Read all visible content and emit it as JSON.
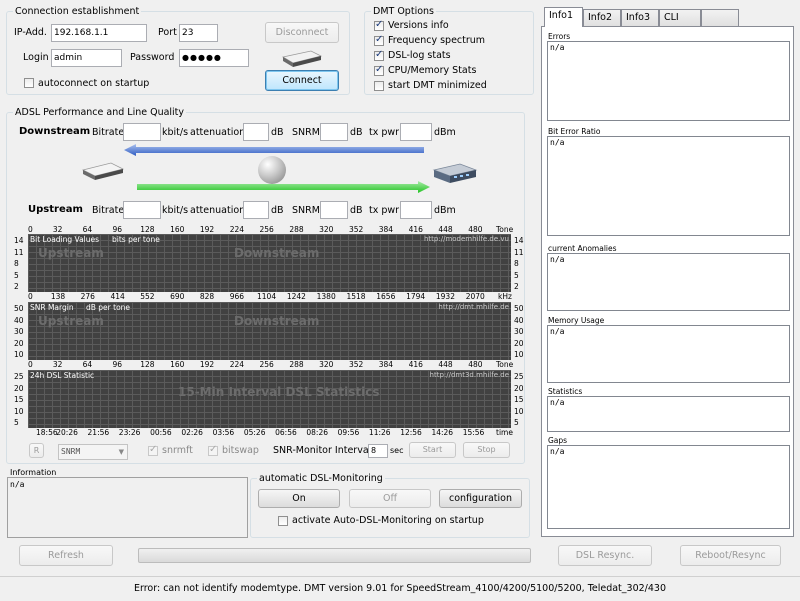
{
  "connection": {
    "title": "Connection establishment",
    "ip_label": "IP-Add.",
    "ip_value": "192.168.1.1",
    "port_label": "Port",
    "port_value": "23",
    "login_label": "Login",
    "login_value": "admin",
    "password_label": "Password",
    "password_value": "●●●●●",
    "disconnect_label": "Disconnect",
    "connect_label": "Connect",
    "autoconnect_label": "autoconnect on startup",
    "autoconnect_checked": false
  },
  "dmt_options": {
    "title": "DMT Options",
    "items": [
      {
        "label": "Versions info",
        "checked": true
      },
      {
        "label": "Frequency spectrum",
        "checked": true
      },
      {
        "label": "DSL-log stats",
        "checked": true
      },
      {
        "label": "CPU/Memory Stats",
        "checked": true
      },
      {
        "label": "start DMT minimized",
        "checked": false
      }
    ]
  },
  "adsl": {
    "title": "ADSL Performance and Line Quality",
    "downstream_label": "Downstream",
    "upstream_label": "Upstream",
    "bitrate_label": "Bitrate",
    "bitrate_unit": "kbit/s",
    "attenuation_label": "attenuation",
    "db_unit": "dB",
    "snrm_label": "SNRM",
    "txpwr_label": "tx pwr",
    "dbm_unit": "dBm",
    "downstream_values": {
      "bitrate": "",
      "attenuation": "",
      "snrm": "",
      "txpwr": ""
    },
    "upstream_values": {
      "bitrate": "",
      "attenuation": "",
      "snrm": "",
      "txpwr": ""
    }
  },
  "charts": {
    "tone_axis": [
      "0",
      "32",
      "64",
      "96",
      "128",
      "160",
      "192",
      "224",
      "256",
      "288",
      "320",
      "352",
      "384",
      "416",
      "448",
      "480",
      "Tone"
    ],
    "khz_axis": [
      "0",
      "138",
      "276",
      "414",
      "552",
      "690",
      "828",
      "966",
      "1104",
      "1242",
      "1380",
      "1518",
      "1656",
      "1794",
      "1932",
      "2070",
      "kHz"
    ],
    "time_axis": [
      "18:56",
      "20:26",
      "21:56",
      "23:26",
      "00:56",
      "02:26",
      "03:56",
      "05:26",
      "06:56",
      "08:26",
      "09:56",
      "11:26",
      "12:56",
      "14:26",
      "15:56",
      "time"
    ],
    "bitloading": {
      "title": "Bit Loading Values",
      "subtitle": "bits per tone",
      "url": "http://modemhilfe.de.vu",
      "wm_up": "Upstream",
      "wm_down": "Downstream",
      "y_ticks": [
        "14",
        "11",
        "8",
        "5",
        "2"
      ]
    },
    "snr": {
      "title": "SNR Margin",
      "subtitle": "dB per tone",
      "url": "http://dmt.mhilfe.de",
      "wm_up": "Upstream",
      "wm_down": "Downstream",
      "y_ticks": [
        "50",
        "40",
        "30",
        "20",
        "10"
      ]
    },
    "stat": {
      "title": "24h DSL Statistic",
      "url": "http://dmt3d.mhilfe.de",
      "wm": "15-Min Interval DSL Statistics",
      "y_ticks": [
        "25",
        "20",
        "15",
        "10",
        "5"
      ]
    }
  },
  "controls": {
    "r_label": "R",
    "select_value": "SNRM",
    "snrmft_label": "snrmft",
    "snrmft_checked": true,
    "bitswap_label": "bitswap",
    "bitswap_checked": true,
    "interval_label": "SNR-Monitor Interval:",
    "interval_value": "8",
    "interval_unit": "sec",
    "start_label": "Start",
    "stop_label": "Stop"
  },
  "information": {
    "title": "Information",
    "value": "n/a"
  },
  "auto_monitor": {
    "title": "automatic DSL-Monitoring",
    "on_label": "On",
    "off_label": "Off",
    "config_label": "configuration",
    "activate_label": "activate Auto-DSL-Monitoring on startup",
    "activate_checked": false
  },
  "tabs": [
    {
      "label": "Info1",
      "active": true
    },
    {
      "label": "Info2",
      "active": false
    },
    {
      "label": "Info3",
      "active": false
    },
    {
      "label": "CLI",
      "active": false
    },
    {
      "label": "",
      "active": false
    }
  ],
  "info_panels": [
    {
      "label": "Errors",
      "value": "n/a"
    },
    {
      "label": "Bit Error Ratio",
      "value": "n/a"
    },
    {
      "label": "current Anomalies",
      "value": "n/a"
    },
    {
      "label": "Memory Usage",
      "value": "n/a"
    },
    {
      "label": "Statistics",
      "value": "n/a"
    },
    {
      "label": "Gaps",
      "value": "n/a"
    }
  ],
  "bottom": {
    "refresh_label": "Refresh",
    "resync_label": "DSL Resync.",
    "reboot_label": "Reboot/Resync",
    "progress": 0
  },
  "status": {
    "text": "Error: can not identify modemtype. DMT version 9.01 for SpeedStream_4100/4200/5100/5200, Teledat_302/430"
  },
  "colors": {
    "downstream_arrow": "#2f5cc2",
    "upstream_arrow": "#22c322",
    "chart_bg": "#414141"
  }
}
